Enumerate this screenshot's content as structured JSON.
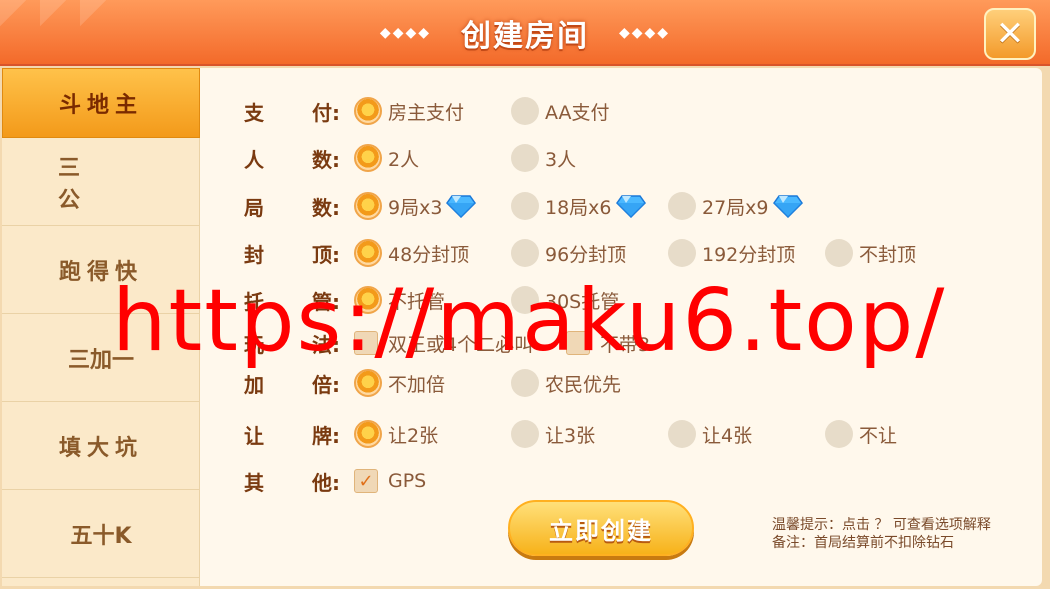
{
  "header": {
    "title": "创建房间",
    "left_decor": "◆◆◆◆",
    "right_decor": "◆◆◆◆",
    "close_label": "✕"
  },
  "sidebar": {
    "items": [
      {
        "label": "斗地主",
        "active": true
      },
      {
        "label": "三公",
        "active": false
      },
      {
        "label": "跑得快",
        "active": false
      },
      {
        "label": "三加一",
        "active": false
      },
      {
        "label": "填大坑",
        "active": false
      },
      {
        "label": "五十K",
        "active": false
      }
    ]
  },
  "settings": {
    "pay": {
      "label_a": "支",
      "label_b": "付:",
      "options": [
        "房主支付",
        "AA支付"
      ],
      "selected": 0
    },
    "players": {
      "label_a": "人",
      "label_b": "数:",
      "options": [
        "2人",
        "3人"
      ],
      "selected": 0
    },
    "rounds": {
      "label_a": "局",
      "label_b": "数:",
      "options": [
        "9局x3",
        "18局x6",
        "27局x9"
      ],
      "selected": 0
    },
    "cap": {
      "label_a": "封",
      "label_b": "顶:",
      "options": [
        "48分封顶",
        "96分封顶",
        "192分封顶",
        "不封顶"
      ],
      "selected": 0
    },
    "trustee": {
      "label_a": "托",
      "label_b": "管:",
      "options": [
        "不托管",
        "30S托管"
      ],
      "selected": 0
    },
    "rules": {
      "label_a": "玩",
      "label_b": "法:",
      "options": [
        "双王或4个二必叫",
        "不带3"
      ]
    },
    "double": {
      "label_a": "加",
      "label_b": "倍:",
      "options": [
        "不加倍",
        "农民优先"
      ],
      "selected": 0
    },
    "concede": {
      "label_a": "让",
      "label_b": "牌:",
      "options": [
        "让2张",
        "让3张",
        "让4张",
        "不让"
      ],
      "selected": 0
    },
    "other": {
      "label_a": "其",
      "label_b": "他:",
      "options": [
        "GPS"
      ],
      "checked": true
    }
  },
  "create_button": "立即创建",
  "tips": {
    "line1": "温馨提示：点击 ？ 可查看选项解释",
    "line2": "备注：首局结算前不扣除钻石"
  },
  "watermark": "https://maku6.top/",
  "colors": {
    "header": "#f36a2a",
    "active_tab": "#f39a1a",
    "panel": "#fff8ec",
    "label": "#7a3a10",
    "watermark": "#ff0000"
  },
  "icons": {
    "gem": "diamond-icon",
    "close": "close-icon"
  }
}
